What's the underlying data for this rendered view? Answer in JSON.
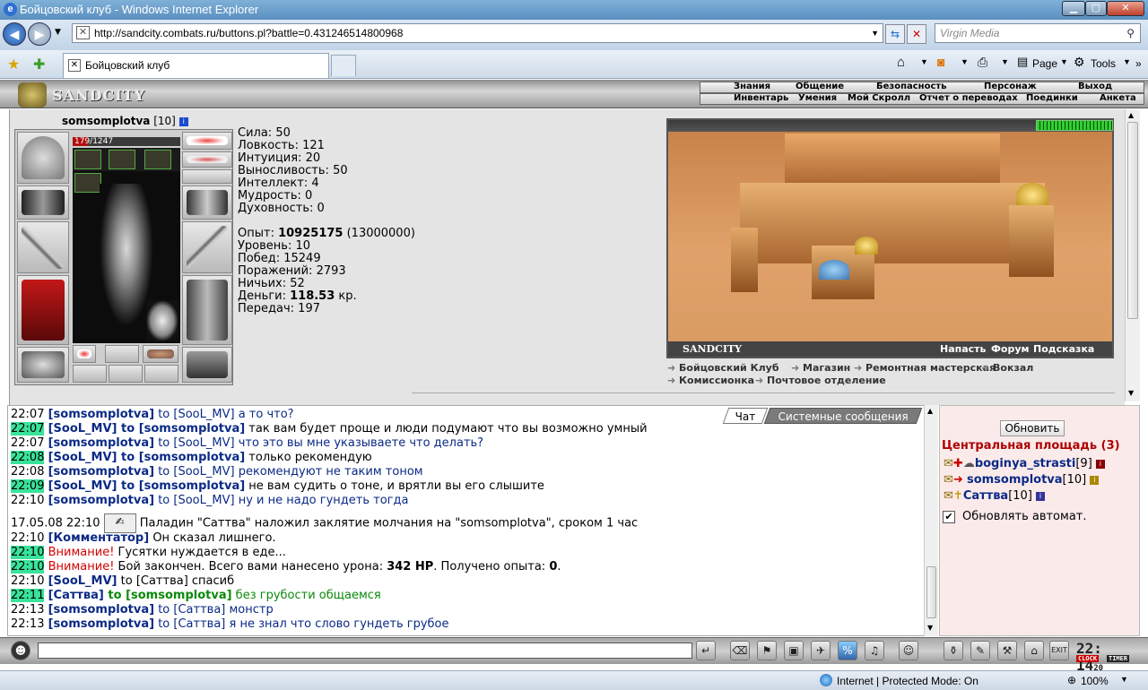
{
  "window": {
    "title": "Бойцовский клуб - Windows Internet Explorer"
  },
  "browser": {
    "url": "http://sandcity.combats.ru/buttons.pl?battle=0.431246514800968",
    "search_placeholder": "Virgin Media",
    "tab_title": "Бойцовский клуб",
    "page_label": "Page",
    "tools_label": "Tools",
    "status_text": "Internet | Protected Mode: On",
    "zoom": "100%"
  },
  "game": {
    "logo": "SANDCITY",
    "menu_top": [
      "Знания",
      "Общение",
      "Безопасность",
      "Персонаж",
      "Выход"
    ],
    "menu_bottom": [
      "Инвентарь",
      "Умения",
      "Мой Скролл",
      "Отчет о переводах",
      "Поединки",
      "Анкета"
    ]
  },
  "character": {
    "name": "somsomplotva",
    "level": "[10]",
    "hp": "179/1247",
    "hp_fraction": 0.1435,
    "stats": [
      {
        "label": "Сила: ",
        "value": "50"
      },
      {
        "label": "Ловкость: ",
        "value": "121"
      },
      {
        "label": "Интуиция: ",
        "value": "20"
      },
      {
        "label": "Выносливость: ",
        "value": "50"
      },
      {
        "label": "Интеллект: ",
        "value": "4"
      },
      {
        "label": "Мудрость: ",
        "value": "0"
      },
      {
        "label": "Духовность: ",
        "value": "0"
      }
    ],
    "exp_label": "Опыт: ",
    "exp_value": "10925175",
    "exp_next": " (13000000)",
    "level_label": "Уровень: 10",
    "wins": "Побед: 15249",
    "losses": "Поражений: 2793",
    "draws": "Ничьих: 52",
    "money_label": "Деньги: ",
    "money_value": "118.53",
    "money_unit": " кр.",
    "transfers": "Передач: 197"
  },
  "city": {
    "name": "SANDCITY",
    "links": [
      "Напасть",
      "Форум",
      "Подсказка"
    ],
    "nav": [
      "Бойцовский Клуб",
      "Магазин",
      "Ремонтная мастерская",
      "Вокзал",
      "Комиссионка",
      "Почтовое отделение"
    ]
  },
  "chat": {
    "tabs": [
      "Чат",
      "Системные сообщения"
    ],
    "messages": [
      {
        "time": "22:07",
        "hl": false,
        "name": "[somsomplotva]",
        "to": " to [SooL_MV]",
        "text": " а то что?",
        "bold_to": false
      },
      {
        "time": "22:07",
        "hl": true,
        "name": "[SooL_MV]",
        "to": " to [somsomplotva]",
        "text": " так вам будет проще и люди подумают что вы возможно умный",
        "bold_to": true
      },
      {
        "time": "22:07",
        "hl": false,
        "name": "[somsomplotva]",
        "to": " to [SooL_MV]",
        "text": " что это вы мне указываете что делать?",
        "bold_to": false
      },
      {
        "time": "22:08",
        "hl": true,
        "name": "[SooL_MV]",
        "to": " to [somsomplotva]",
        "text": " только рекомендую",
        "bold_to": true
      },
      {
        "time": "22:08",
        "hl": false,
        "name": "[somsomplotva]",
        "to": " to [SooL_MV]",
        "text": " рекомендуют не таким тоном",
        "bold_to": false
      },
      {
        "time": "22:09",
        "hl": true,
        "name": "[SooL_MV]",
        "to": " to [somsomplotva]",
        "text": " не вам судить о тоне, и врятли вы его слышите",
        "bold_to": true
      },
      {
        "time": "22:10",
        "hl": false,
        "name": "[somsomplotva]",
        "to": " to [SooL_MV]",
        "text": " ну и не надо гундеть тогда",
        "bold_to": false
      }
    ],
    "silence": {
      "time": "17.05.08 22:10",
      "text": " Паладин \"Саттва\" наложил заклятие молчания на \"somsomplotva\", сроком 1 час"
    },
    "commentator": {
      "time": "22:10",
      "name": "[Комментатор]",
      "text": " Он сказал лишнего."
    },
    "warn1": {
      "time": "22:10",
      "label": "Внимание!",
      "text": " Гусятки нуждается в еде..."
    },
    "warn2": {
      "time": "22:10",
      "label": "Внимание!",
      "text": " Бой закончен. Всего вами нанесено урона: ",
      "dmg": "342 HP",
      "mid": ". Получено опыта: ",
      "exp": "0",
      "end": "."
    },
    "m_sool": {
      "time": "22:10",
      "name": "[SooL_MV]",
      "text": " to [Саттва] спасиб"
    },
    "m_sattva": {
      "time": "22:11",
      "name": "[Саттва]",
      "to": " to [somsomplotva]",
      "text": " без грубости общаемся"
    },
    "m_last1": {
      "time": "22:13",
      "name": "[somsomplotva]",
      "text": " to [Саттва] монстр"
    },
    "m_last2": {
      "time": "22:13",
      "name": "[somsomplotva]",
      "text": " to [Саттва] я не знал что слово гундеть грубое"
    }
  },
  "online": {
    "refresh": "Обновить",
    "room": "Центральная площадь (3)",
    "users": [
      {
        "name": "boginya_strasti",
        "level": "[9]"
      },
      {
        "name": "somsomplotva",
        "level": "[10]"
      },
      {
        "name": "Саттва",
        "level": "[10]"
      }
    ],
    "auto_refresh": "Обновлять автомат.",
    "check": "✔"
  },
  "clock": {
    "time": "22: 14",
    "sec": "20",
    "label1": "CLOCK",
    "label2": "TIMER"
  }
}
